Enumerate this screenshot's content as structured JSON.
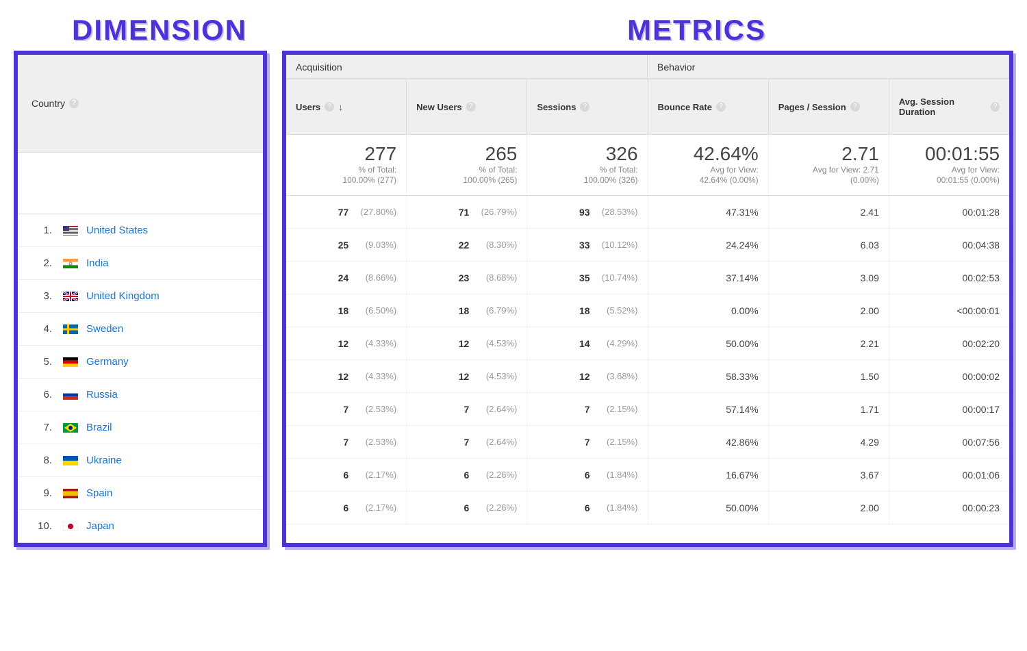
{
  "callouts": {
    "dimension": "DIMENSION",
    "metrics": "METRICS"
  },
  "dimension": {
    "header_label": "Country",
    "rows": [
      {
        "idx": "1.",
        "country": "United States",
        "flag": "us"
      },
      {
        "idx": "2.",
        "country": "India",
        "flag": "in"
      },
      {
        "idx": "3.",
        "country": "United Kingdom",
        "flag": "gb"
      },
      {
        "idx": "4.",
        "country": "Sweden",
        "flag": "se"
      },
      {
        "idx": "5.",
        "country": "Germany",
        "flag": "de"
      },
      {
        "idx": "6.",
        "country": "Russia",
        "flag": "ru"
      },
      {
        "idx": "7.",
        "country": "Brazil",
        "flag": "br"
      },
      {
        "idx": "8.",
        "country": "Ukraine",
        "flag": "ua"
      },
      {
        "idx": "9.",
        "country": "Spain",
        "flag": "es"
      },
      {
        "idx": "10.",
        "country": "Japan",
        "flag": "jp"
      }
    ]
  },
  "metrics": {
    "groups": {
      "acquisition": "Acquisition",
      "behavior": "Behavior"
    },
    "columns": [
      {
        "key": "users",
        "label": "Users",
        "sorted_desc": true
      },
      {
        "key": "new_users",
        "label": "New Users",
        "sorted_desc": false
      },
      {
        "key": "sessions",
        "label": "Sessions",
        "sorted_desc": false
      },
      {
        "key": "bounce",
        "label": "Bounce Rate",
        "sorted_desc": false
      },
      {
        "key": "pps",
        "label": "Pages / Session",
        "sorted_desc": false
      },
      {
        "key": "asd",
        "label": "Avg. Session Duration",
        "sorted_desc": false
      }
    ],
    "summary": {
      "users": {
        "big": "277",
        "sub1": "% of Total:",
        "sub2": "100.00% (277)"
      },
      "new_users": {
        "big": "265",
        "sub1": "% of Total:",
        "sub2": "100.00% (265)"
      },
      "sessions": {
        "big": "326",
        "sub1": "% of Total:",
        "sub2": "100.00% (326)"
      },
      "bounce": {
        "big": "42.64%",
        "sub1": "Avg for View:",
        "sub2": "42.64% (0.00%)"
      },
      "pps": {
        "big": "2.71",
        "sub1": "Avg for View: 2.71",
        "sub2": "(0.00%)"
      },
      "asd": {
        "big": "00:01:55",
        "sub1": "Avg for View:",
        "sub2": "00:01:55 (0.00%)"
      }
    },
    "rows": [
      {
        "users": {
          "v": "77",
          "p": "(27.80%)"
        },
        "new_users": {
          "v": "71",
          "p": "(26.79%)"
        },
        "sessions": {
          "v": "93",
          "p": "(28.53%)"
        },
        "bounce": "47.31%",
        "pps": "2.41",
        "asd": "00:01:28"
      },
      {
        "users": {
          "v": "25",
          "p": "(9.03%)"
        },
        "new_users": {
          "v": "22",
          "p": "(8.30%)"
        },
        "sessions": {
          "v": "33",
          "p": "(10.12%)"
        },
        "bounce": "24.24%",
        "pps": "6.03",
        "asd": "00:04:38"
      },
      {
        "users": {
          "v": "24",
          "p": "(8.66%)"
        },
        "new_users": {
          "v": "23",
          "p": "(8.68%)"
        },
        "sessions": {
          "v": "35",
          "p": "(10.74%)"
        },
        "bounce": "37.14%",
        "pps": "3.09",
        "asd": "00:02:53"
      },
      {
        "users": {
          "v": "18",
          "p": "(6.50%)"
        },
        "new_users": {
          "v": "18",
          "p": "(6.79%)"
        },
        "sessions": {
          "v": "18",
          "p": "(5.52%)"
        },
        "bounce": "0.00%",
        "pps": "2.00",
        "asd": "<00:00:01"
      },
      {
        "users": {
          "v": "12",
          "p": "(4.33%)"
        },
        "new_users": {
          "v": "12",
          "p": "(4.53%)"
        },
        "sessions": {
          "v": "14",
          "p": "(4.29%)"
        },
        "bounce": "50.00%",
        "pps": "2.21",
        "asd": "00:02:20"
      },
      {
        "users": {
          "v": "12",
          "p": "(4.33%)"
        },
        "new_users": {
          "v": "12",
          "p": "(4.53%)"
        },
        "sessions": {
          "v": "12",
          "p": "(3.68%)"
        },
        "bounce": "58.33%",
        "pps": "1.50",
        "asd": "00:00:02"
      },
      {
        "users": {
          "v": "7",
          "p": "(2.53%)"
        },
        "new_users": {
          "v": "7",
          "p": "(2.64%)"
        },
        "sessions": {
          "v": "7",
          "p": "(2.15%)"
        },
        "bounce": "57.14%",
        "pps": "1.71",
        "asd": "00:00:17"
      },
      {
        "users": {
          "v": "7",
          "p": "(2.53%)"
        },
        "new_users": {
          "v": "7",
          "p": "(2.64%)"
        },
        "sessions": {
          "v": "7",
          "p": "(2.15%)"
        },
        "bounce": "42.86%",
        "pps": "4.29",
        "asd": "00:07:56"
      },
      {
        "users": {
          "v": "6",
          "p": "(2.17%)"
        },
        "new_users": {
          "v": "6",
          "p": "(2.26%)"
        },
        "sessions": {
          "v": "6",
          "p": "(1.84%)"
        },
        "bounce": "16.67%",
        "pps": "3.67",
        "asd": "00:01:06"
      },
      {
        "users": {
          "v": "6",
          "p": "(2.17%)"
        },
        "new_users": {
          "v": "6",
          "p": "(2.26%)"
        },
        "sessions": {
          "v": "6",
          "p": "(1.84%)"
        },
        "bounce": "50.00%",
        "pps": "2.00",
        "asd": "00:00:23"
      }
    ]
  },
  "chart_data": {
    "type": "table",
    "dimension": "Country",
    "metrics": [
      "Users",
      "New Users",
      "Sessions",
      "Bounce Rate",
      "Pages / Session",
      "Avg. Session Duration"
    ],
    "totals": {
      "Users": 277,
      "New Users": 265,
      "Sessions": 326,
      "Bounce Rate": "42.64%",
      "Pages / Session": 2.71,
      "Avg. Session Duration": "00:01:55"
    },
    "rows": [
      {
        "Country": "United States",
        "Users": 77,
        "New Users": 71,
        "Sessions": 93,
        "Bounce Rate": "47.31%",
        "Pages / Session": 2.41,
        "Avg. Session Duration": "00:01:28"
      },
      {
        "Country": "India",
        "Users": 25,
        "New Users": 22,
        "Sessions": 33,
        "Bounce Rate": "24.24%",
        "Pages / Session": 6.03,
        "Avg. Session Duration": "00:04:38"
      },
      {
        "Country": "United Kingdom",
        "Users": 24,
        "New Users": 23,
        "Sessions": 35,
        "Bounce Rate": "37.14%",
        "Pages / Session": 3.09,
        "Avg. Session Duration": "00:02:53"
      },
      {
        "Country": "Sweden",
        "Users": 18,
        "New Users": 18,
        "Sessions": 18,
        "Bounce Rate": "0.00%",
        "Pages / Session": 2.0,
        "Avg. Session Duration": "<00:00:01"
      },
      {
        "Country": "Germany",
        "Users": 12,
        "New Users": 12,
        "Sessions": 14,
        "Bounce Rate": "50.00%",
        "Pages / Session": 2.21,
        "Avg. Session Duration": "00:02:20"
      },
      {
        "Country": "Russia",
        "Users": 12,
        "New Users": 12,
        "Sessions": 12,
        "Bounce Rate": "58.33%",
        "Pages / Session": 1.5,
        "Avg. Session Duration": "00:00:02"
      },
      {
        "Country": "Brazil",
        "Users": 7,
        "New Users": 7,
        "Sessions": 7,
        "Bounce Rate": "57.14%",
        "Pages / Session": 1.71,
        "Avg. Session Duration": "00:00:17"
      },
      {
        "Country": "Ukraine",
        "Users": 7,
        "New Users": 7,
        "Sessions": 7,
        "Bounce Rate": "42.86%",
        "Pages / Session": 4.29,
        "Avg. Session Duration": "00:07:56"
      },
      {
        "Country": "Spain",
        "Users": 6,
        "New Users": 6,
        "Sessions": 6,
        "Bounce Rate": "16.67%",
        "Pages / Session": 3.67,
        "Avg. Session Duration": "00:01:06"
      },
      {
        "Country": "Japan",
        "Users": 6,
        "New Users": 6,
        "Sessions": 6,
        "Bounce Rate": "50.00%",
        "Pages / Session": 2.0,
        "Avg. Session Duration": "00:00:23"
      }
    ]
  }
}
